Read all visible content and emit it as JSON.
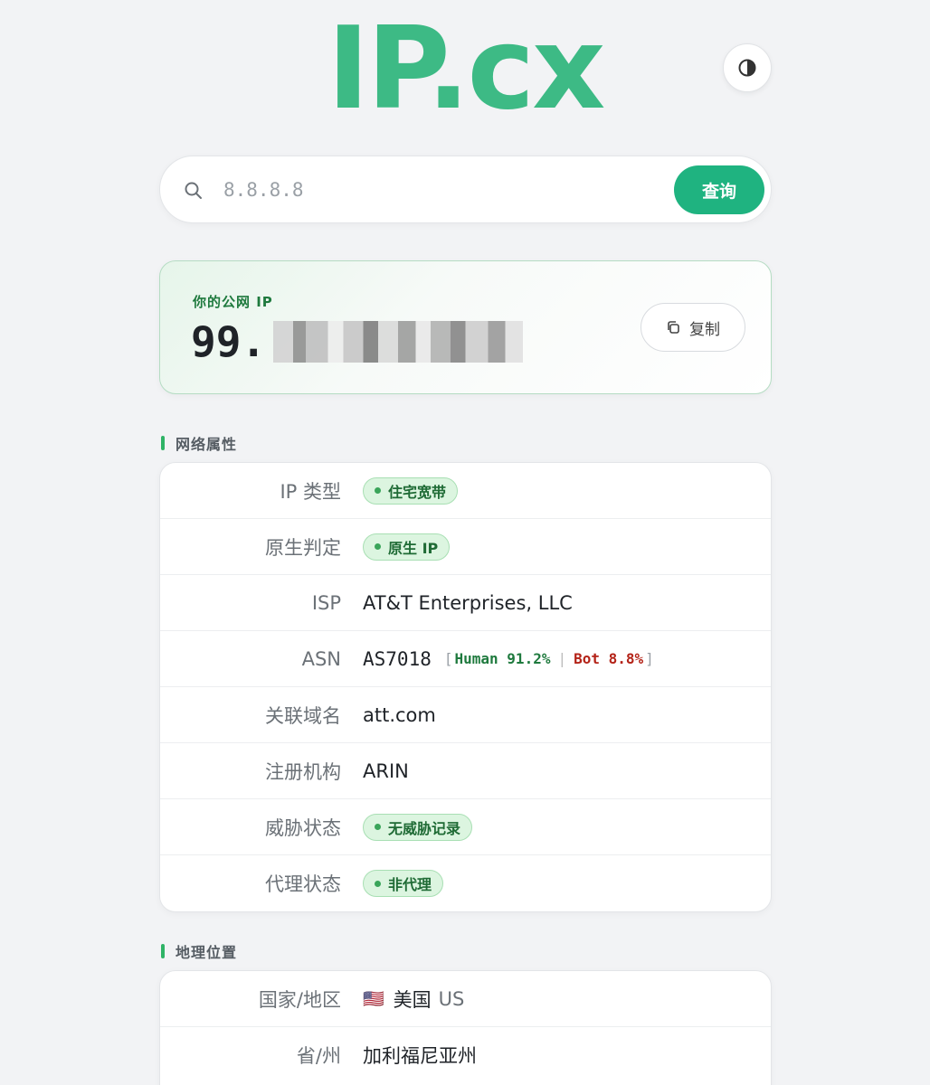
{
  "logo": {
    "text": "IP.cx",
    "color": "#3dba85"
  },
  "header": {
    "theme_icon": "contrast-icon"
  },
  "search": {
    "placeholder": "8.8.8.8",
    "button_label": "查询"
  },
  "ip_card": {
    "label": "你的公网 IP",
    "ip_visible_prefix": "99.",
    "copy_label": "复制"
  },
  "network": {
    "title": "网络属性",
    "rows": {
      "ip_type": {
        "label": "IP 类型",
        "value": "住宅宽带"
      },
      "native": {
        "label": "原生判定",
        "value": "原生 IP"
      },
      "isp": {
        "label": "ISP",
        "value": "AT&T Enterprises, LLC"
      },
      "asn": {
        "label": "ASN",
        "value": "AS7018",
        "open_bracket": "[",
        "human": "Human 91.2%",
        "sep": "|",
        "bot": "Bot 8.8%",
        "close_bracket": "]"
      },
      "domain": {
        "label": "关联域名",
        "value": "att.com"
      },
      "registry": {
        "label": "注册机构",
        "value": "ARIN"
      },
      "threat": {
        "label": "威胁状态",
        "value": "无威胁记录"
      },
      "proxy": {
        "label": "代理状态",
        "value": "非代理"
      }
    }
  },
  "geo": {
    "title": "地理位置",
    "rows": {
      "country": {
        "label": "国家/地区",
        "flag": "🇺🇸",
        "value": "美国",
        "code": "US"
      },
      "state": {
        "label": "省/州",
        "value": "加利福尼亚州"
      }
    }
  },
  "colors": {
    "accent": "#1fb380",
    "badge_bg": "#dcf5e0",
    "human": "#1f7a3e",
    "bot": "#b42318"
  }
}
